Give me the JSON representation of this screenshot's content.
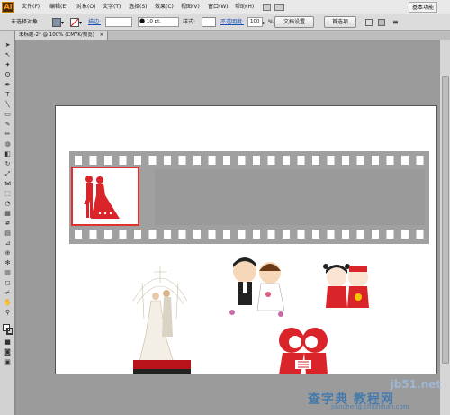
{
  "app": {
    "logo_text": "Ai",
    "workspace_label": "基本功能"
  },
  "menu": [
    {
      "label": "文件(F)"
    },
    {
      "label": "编辑(E)"
    },
    {
      "label": "对象(O)"
    },
    {
      "label": "文字(T)"
    },
    {
      "label": "选择(S)"
    },
    {
      "label": "效果(C)"
    },
    {
      "label": "视图(V)"
    },
    {
      "label": "窗口(W)"
    },
    {
      "label": "帮助(H)"
    }
  ],
  "controlbar": {
    "selection_status": "未选择对象",
    "stroke_label": "描边:",
    "brush_value": "10 pt.",
    "style_label": "样式:",
    "opacity_label": "不透明度:",
    "opacity_value": "100",
    "opacity_unit": "%",
    "doc_setup_button": "文档设置",
    "prefs_button": "首选项"
  },
  "document": {
    "tab_title": "未标题-2* @ 100% (CMYK/预览)",
    "tab_close": "×"
  },
  "watermark": {
    "site": "jb51.net",
    "brand": "查字典 教程网",
    "url": "jiaocheng.chazidian.com"
  },
  "colors": {
    "film": "#a0a0a0",
    "accent_red": "#d9252a",
    "frame_red": "#e03030"
  },
  "artwork": {
    "film_frames": 1,
    "icons": [
      "wedding-silhouette-icon",
      "church-couple-icon",
      "cartoon-couple-icon",
      "kissing-kids-icon",
      "red-kissing-couple-icon"
    ]
  }
}
